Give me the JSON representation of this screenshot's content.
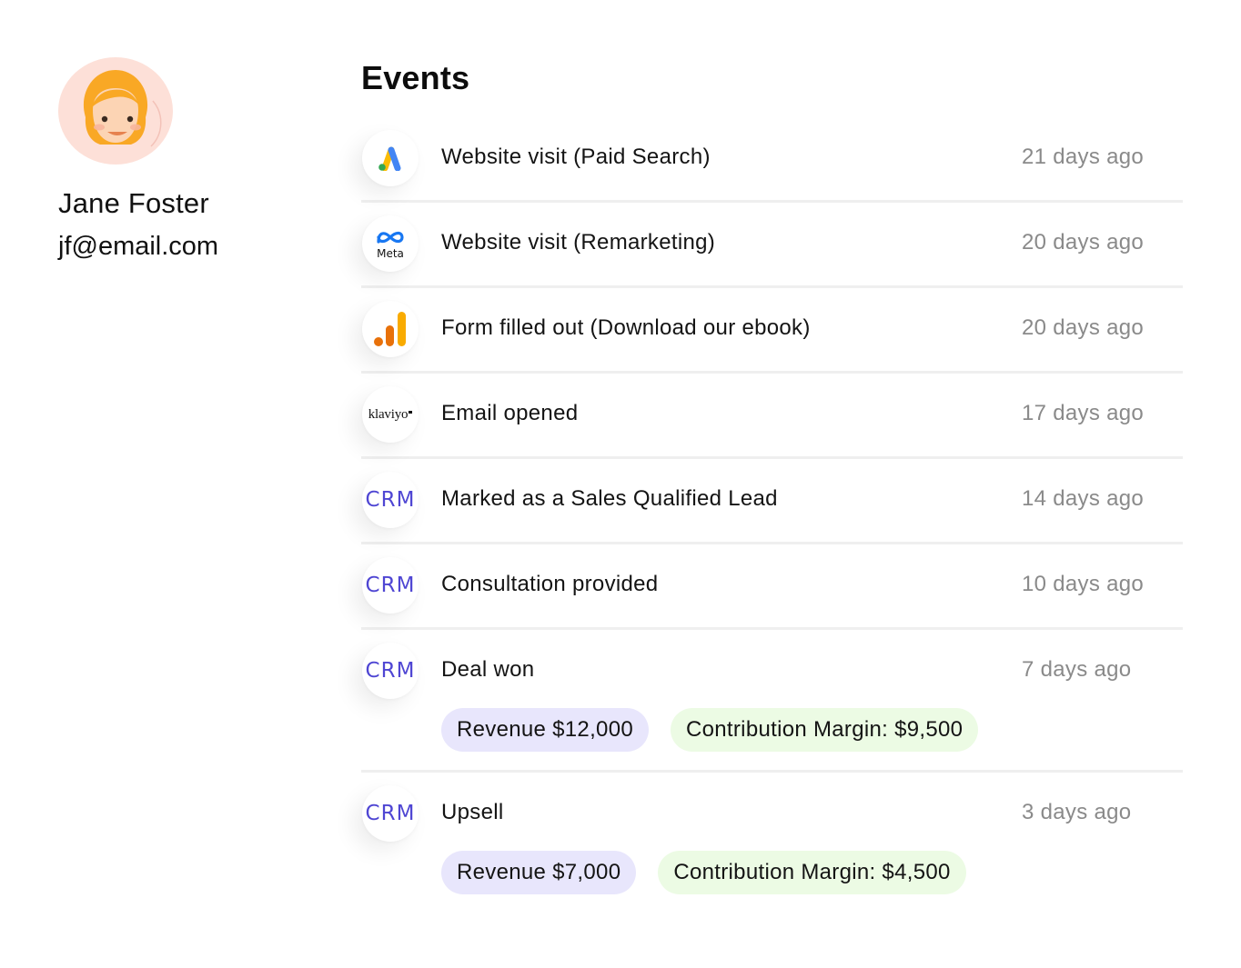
{
  "profile": {
    "name": "Jane Foster",
    "email": "jf@email.com"
  },
  "events_title": "Events",
  "events": [
    {
      "icon": "google-ads-icon",
      "label": "Website visit (Paid Search)",
      "time": "21 days ago"
    },
    {
      "icon": "meta-icon",
      "icon_text": "Meta",
      "label": "Website visit (Remarketing)",
      "time": "20 days ago"
    },
    {
      "icon": "google-analytics-icon",
      "label": "Form filled out (Download our ebook)",
      "time": "20 days ago"
    },
    {
      "icon": "klaviyo-icon",
      "icon_text": "klaviyo",
      "label": "Email opened",
      "time": "17 days ago"
    },
    {
      "icon": "crm-icon",
      "icon_text": "CRM",
      "label": "Marked as a Sales Qualified Lead",
      "time": "14 days ago"
    },
    {
      "icon": "crm-icon",
      "icon_text": "CRM",
      "label": "Consultation provided",
      "time": "10 days ago"
    },
    {
      "icon": "crm-icon",
      "icon_text": "CRM",
      "label": "Deal won",
      "time": "7 days ago",
      "tags": [
        "Revenue $12,000",
        "Contribution Margin: $9,500"
      ]
    },
    {
      "icon": "crm-icon",
      "icon_text": "CRM",
      "label": "Upsell",
      "time": "3 days ago",
      "tags": [
        "Revenue $7,000",
        "Contribution Margin: $4,500"
      ]
    }
  ],
  "colors": {
    "crm_accent": "#4f46d3",
    "revenue_pill": "#e8e6fc",
    "margin_pill": "#ecfbe4",
    "avatar_bg": "#fde0d8",
    "avatar_hair": "#f9a825"
  }
}
